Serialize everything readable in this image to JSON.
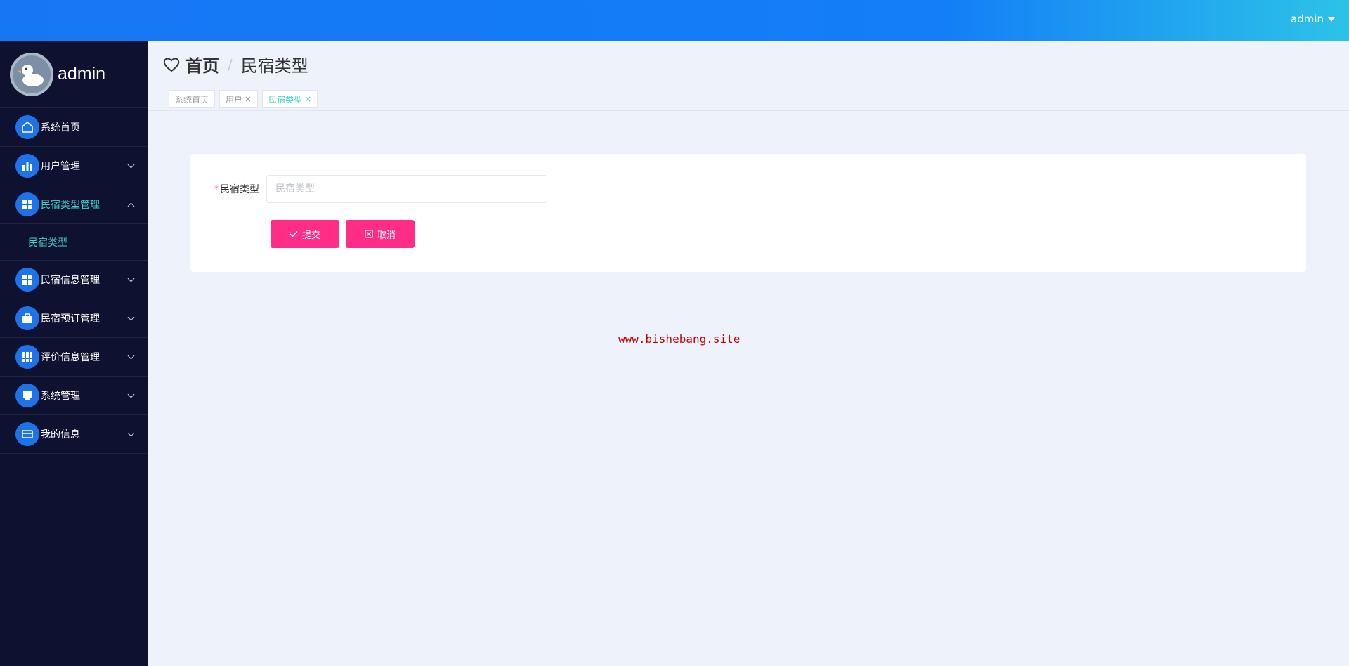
{
  "topbar": {
    "user": "admin"
  },
  "sidebar": {
    "username": "admin",
    "items": [
      {
        "label": "系统首页",
        "icon": "home-icon"
      },
      {
        "label": "用户管理",
        "icon": "bar-chart-icon"
      },
      {
        "label": "民宿类型管理",
        "icon": "grid-icon",
        "open": true,
        "children": [
          {
            "label": "民宿类型"
          }
        ]
      },
      {
        "label": "民宿信息管理",
        "icon": "grid-icon"
      },
      {
        "label": "民宿预订管理",
        "icon": "briefcase-icon"
      },
      {
        "label": "评价信息管理",
        "icon": "table-icon"
      },
      {
        "label": "系统管理",
        "icon": "monitor-icon"
      },
      {
        "label": "我的信息",
        "icon": "card-icon"
      }
    ]
  },
  "breadcrumb": {
    "home": "首页",
    "separator": "/",
    "current": "民宿类型"
  },
  "tabs": [
    {
      "label": "系统首页",
      "closable": false
    },
    {
      "label": "用户",
      "closable": true
    },
    {
      "label": "民宿类型",
      "closable": true,
      "active": true
    }
  ],
  "form": {
    "required_mark": "*",
    "label": "民宿类型",
    "value": "",
    "placeholder": "民宿类型",
    "submit_label": "提交",
    "cancel_label": "取消"
  },
  "watermark": "www.bishebang.site",
  "colors": {
    "accent": "#1677f5",
    "teal": "#3fd2c7",
    "button": "#ff2d86",
    "sidebar": "#0f1130"
  }
}
